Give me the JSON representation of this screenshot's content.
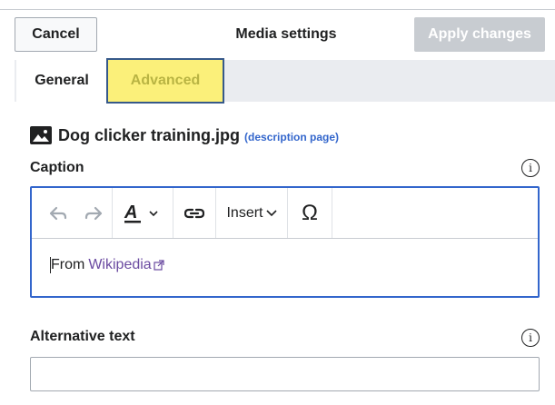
{
  "header": {
    "cancel_label": "Cancel",
    "title": "Media settings",
    "apply_label": "Apply changes"
  },
  "tabs": [
    {
      "label": "General",
      "selected": true
    },
    {
      "label": "Advanced",
      "selected": false
    }
  ],
  "file": {
    "icon": "image-icon",
    "name": "Dog clicker training.jpg",
    "description_link": "(description page)"
  },
  "caption": {
    "label": "Caption",
    "info_icon": "info-icon",
    "toolbar": {
      "undo_icon": "undo-icon",
      "redo_icon": "redo-icon",
      "style_icon": "text-style-icon",
      "link_icon": "link-icon",
      "insert_label": "Insert",
      "special_char": "Ω"
    },
    "content_prefix": "From",
    "content_link": "Wikipedia"
  },
  "alt_text": {
    "label": "Alternative text",
    "info_icon": "info-icon",
    "value": "",
    "placeholder": ""
  },
  "colors": {
    "accent": "#3366cc",
    "advanced_highlight": "#fbf07a",
    "visited_link": "#6b4ba1",
    "disabled_button": "#c8ccd1"
  }
}
